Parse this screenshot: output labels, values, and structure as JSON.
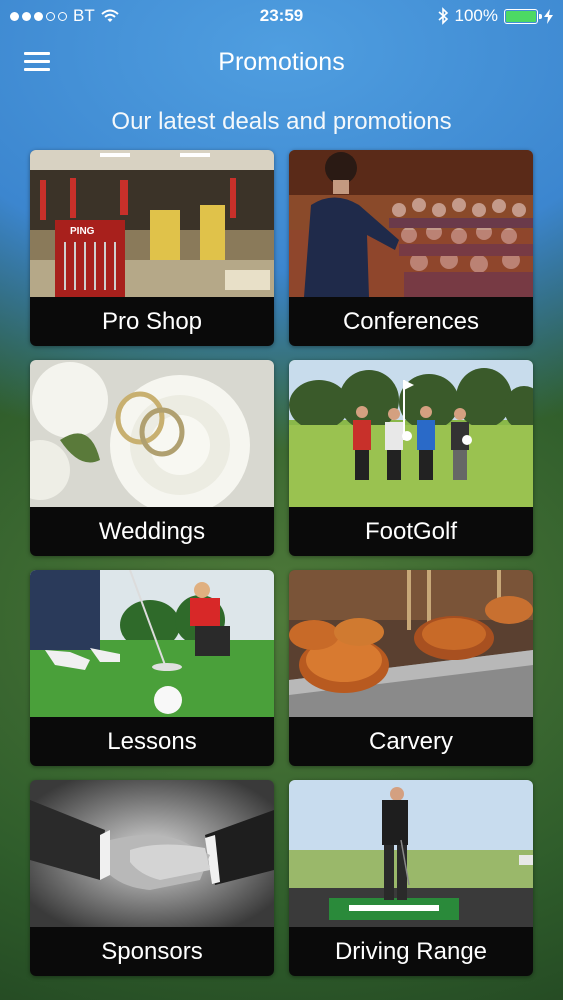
{
  "status_bar": {
    "carrier": "BT",
    "time": "23:59",
    "battery": "100%",
    "battery_level": 1.0
  },
  "header": {
    "title": "Promotions"
  },
  "subtitle": "Our latest deals and promotions",
  "tiles": [
    {
      "label": "Pro Shop"
    },
    {
      "label": "Conferences"
    },
    {
      "label": "Weddings"
    },
    {
      "label": "FootGolf"
    },
    {
      "label": "Lessons"
    },
    {
      "label": "Carvery"
    },
    {
      "label": "Sponsors"
    },
    {
      "label": "Driving Range"
    }
  ],
  "colors": {
    "battery_green": "#4cd964",
    "label_bar": "#0a0a0a"
  }
}
